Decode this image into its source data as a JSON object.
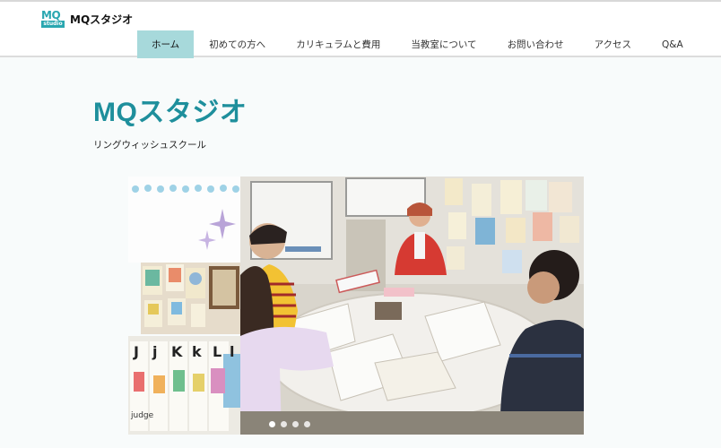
{
  "header": {
    "logo_mark": "MQ",
    "logo_sub": "studio",
    "brand": "MQスタジオ"
  },
  "nav": {
    "items": [
      {
        "label": "ホーム",
        "active": true
      },
      {
        "label": "初めての方へ"
      },
      {
        "label": "カリキュラムと費用"
      },
      {
        "label": "当教室について"
      },
      {
        "label": "お問い合わせ"
      },
      {
        "label": "アクセス"
      },
      {
        "label": "Q&A"
      }
    ]
  },
  "hero": {
    "title": "MQスタジオ",
    "subtitle": "リングウィッシュスクール"
  },
  "collage": {
    "card_letters": [
      "J",
      "j",
      "K",
      "k",
      "L",
      "l"
    ],
    "card_caption": "judge"
  },
  "colors": {
    "accent": "#1e8f9c",
    "nav_active_bg": "#a7d9db",
    "logo": "#2aa7b0"
  }
}
